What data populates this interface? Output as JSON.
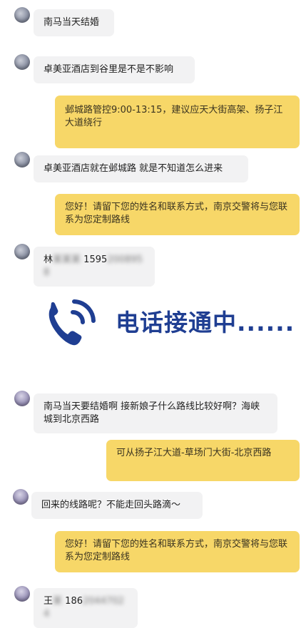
{
  "messages": [
    {
      "text": "南马当天结婚"
    },
    {
      "text": "卓美亚酒店到谷里是不是不影响"
    },
    {
      "text": "邺城路管控9:00-13:15，建议应天大街高架、扬子江大道绕行"
    },
    {
      "text": "卓美亚酒店就在邺城路 就是不知道怎么进来"
    },
    {
      "text": "您好！请留下您的姓名和联系方式，南京交警将与您联系为您定制路线"
    },
    {
      "text_visible": "林",
      "text_blurred": "某某某",
      "phone_visible": "1595",
      "phone_blurred": "2008958"
    },
    {
      "text": "南马当天要结婚啊 接新娘子什么路线比较好啊？海峡城到北京西路"
    },
    {
      "text": "可从扬子江大道-草场门大街-北京西路"
    },
    {
      "text": "回来的线路呢？不能走回头路滴～"
    },
    {
      "text": "您好！请留下您的姓名和联系方式，南京交警将与您联系为您定制路线"
    },
    {
      "text_visible": "王",
      "text_blurred": "某",
      "phone_visible": "186",
      "phone_blurred": "20447024"
    }
  ],
  "banner": {
    "text": "电话接通中......",
    "icon": "phone-call-icon",
    "color": "#1f3e92"
  },
  "colors": {
    "incoming_bubble": "#f2f2f3",
    "outgoing_bubble": "#f7d768"
  }
}
